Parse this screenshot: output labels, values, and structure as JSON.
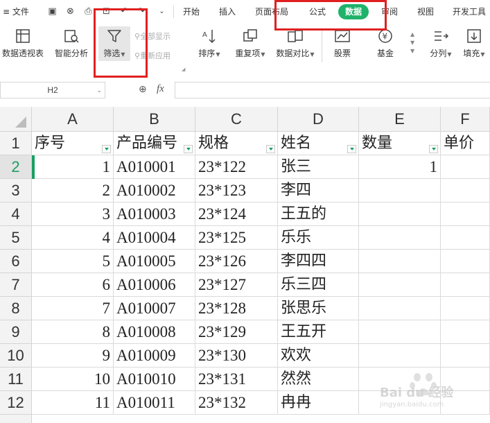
{
  "menubar": {
    "file_label": "文件",
    "tabs": [
      "开始",
      "插入",
      "页面布局",
      "公式",
      "数据",
      "审阅",
      "视图",
      "开发工具"
    ],
    "active_tab": "数据",
    "accent": "#1fb36a"
  },
  "ribbon": {
    "pivot": "数据透视表",
    "smart": "智能分析",
    "filter": "筛选",
    "show_all": "全部显示",
    "reapply": "重新应用",
    "sort": "排序",
    "duplicates": "重复项",
    "compare": "数据对比",
    "stock": "股票",
    "fund": "基金",
    "split": "分列",
    "fill": "填充"
  },
  "formula_bar": {
    "name_box": "H2",
    "fx": "fx",
    "value": ""
  },
  "sheet": {
    "columns": [
      "A",
      "B",
      "C",
      "D",
      "E",
      "F"
    ],
    "rows": [
      "1",
      "2",
      "3",
      "4",
      "5",
      "6",
      "7",
      "8",
      "9",
      "10",
      "11",
      "12"
    ],
    "header_row": [
      "序号",
      "产品编号",
      "规格",
      "姓名",
      "数量",
      "单价"
    ],
    "data": [
      [
        "1",
        "A010001",
        "23*122",
        "张三",
        "1",
        ""
      ],
      [
        "2",
        "A010002",
        "23*123",
        "李四",
        "",
        ""
      ],
      [
        "3",
        "A010003",
        "23*124",
        "王五的",
        "",
        ""
      ],
      [
        "4",
        "A010004",
        "23*125",
        "乐乐",
        "",
        ""
      ],
      [
        "5",
        "A010005",
        "23*126",
        "李四四",
        "",
        ""
      ],
      [
        "6",
        "A010006",
        "23*127",
        "乐三四",
        "",
        ""
      ],
      [
        "7",
        "A010007",
        "23*128",
        "张思乐",
        "",
        ""
      ],
      [
        "8",
        "A010008",
        "23*129",
        "王五开",
        "",
        ""
      ],
      [
        "9",
        "A010009",
        "23*130",
        "欢欢",
        "",
        ""
      ],
      [
        "10",
        "A010010",
        "23*131",
        "然然",
        "",
        ""
      ],
      [
        "11",
        "A010011",
        "23*132",
        "冉冉",
        "",
        ""
      ]
    ]
  },
  "watermark": {
    "brand": "Bai du 经验",
    "url": "jingyan.baidu.com"
  }
}
